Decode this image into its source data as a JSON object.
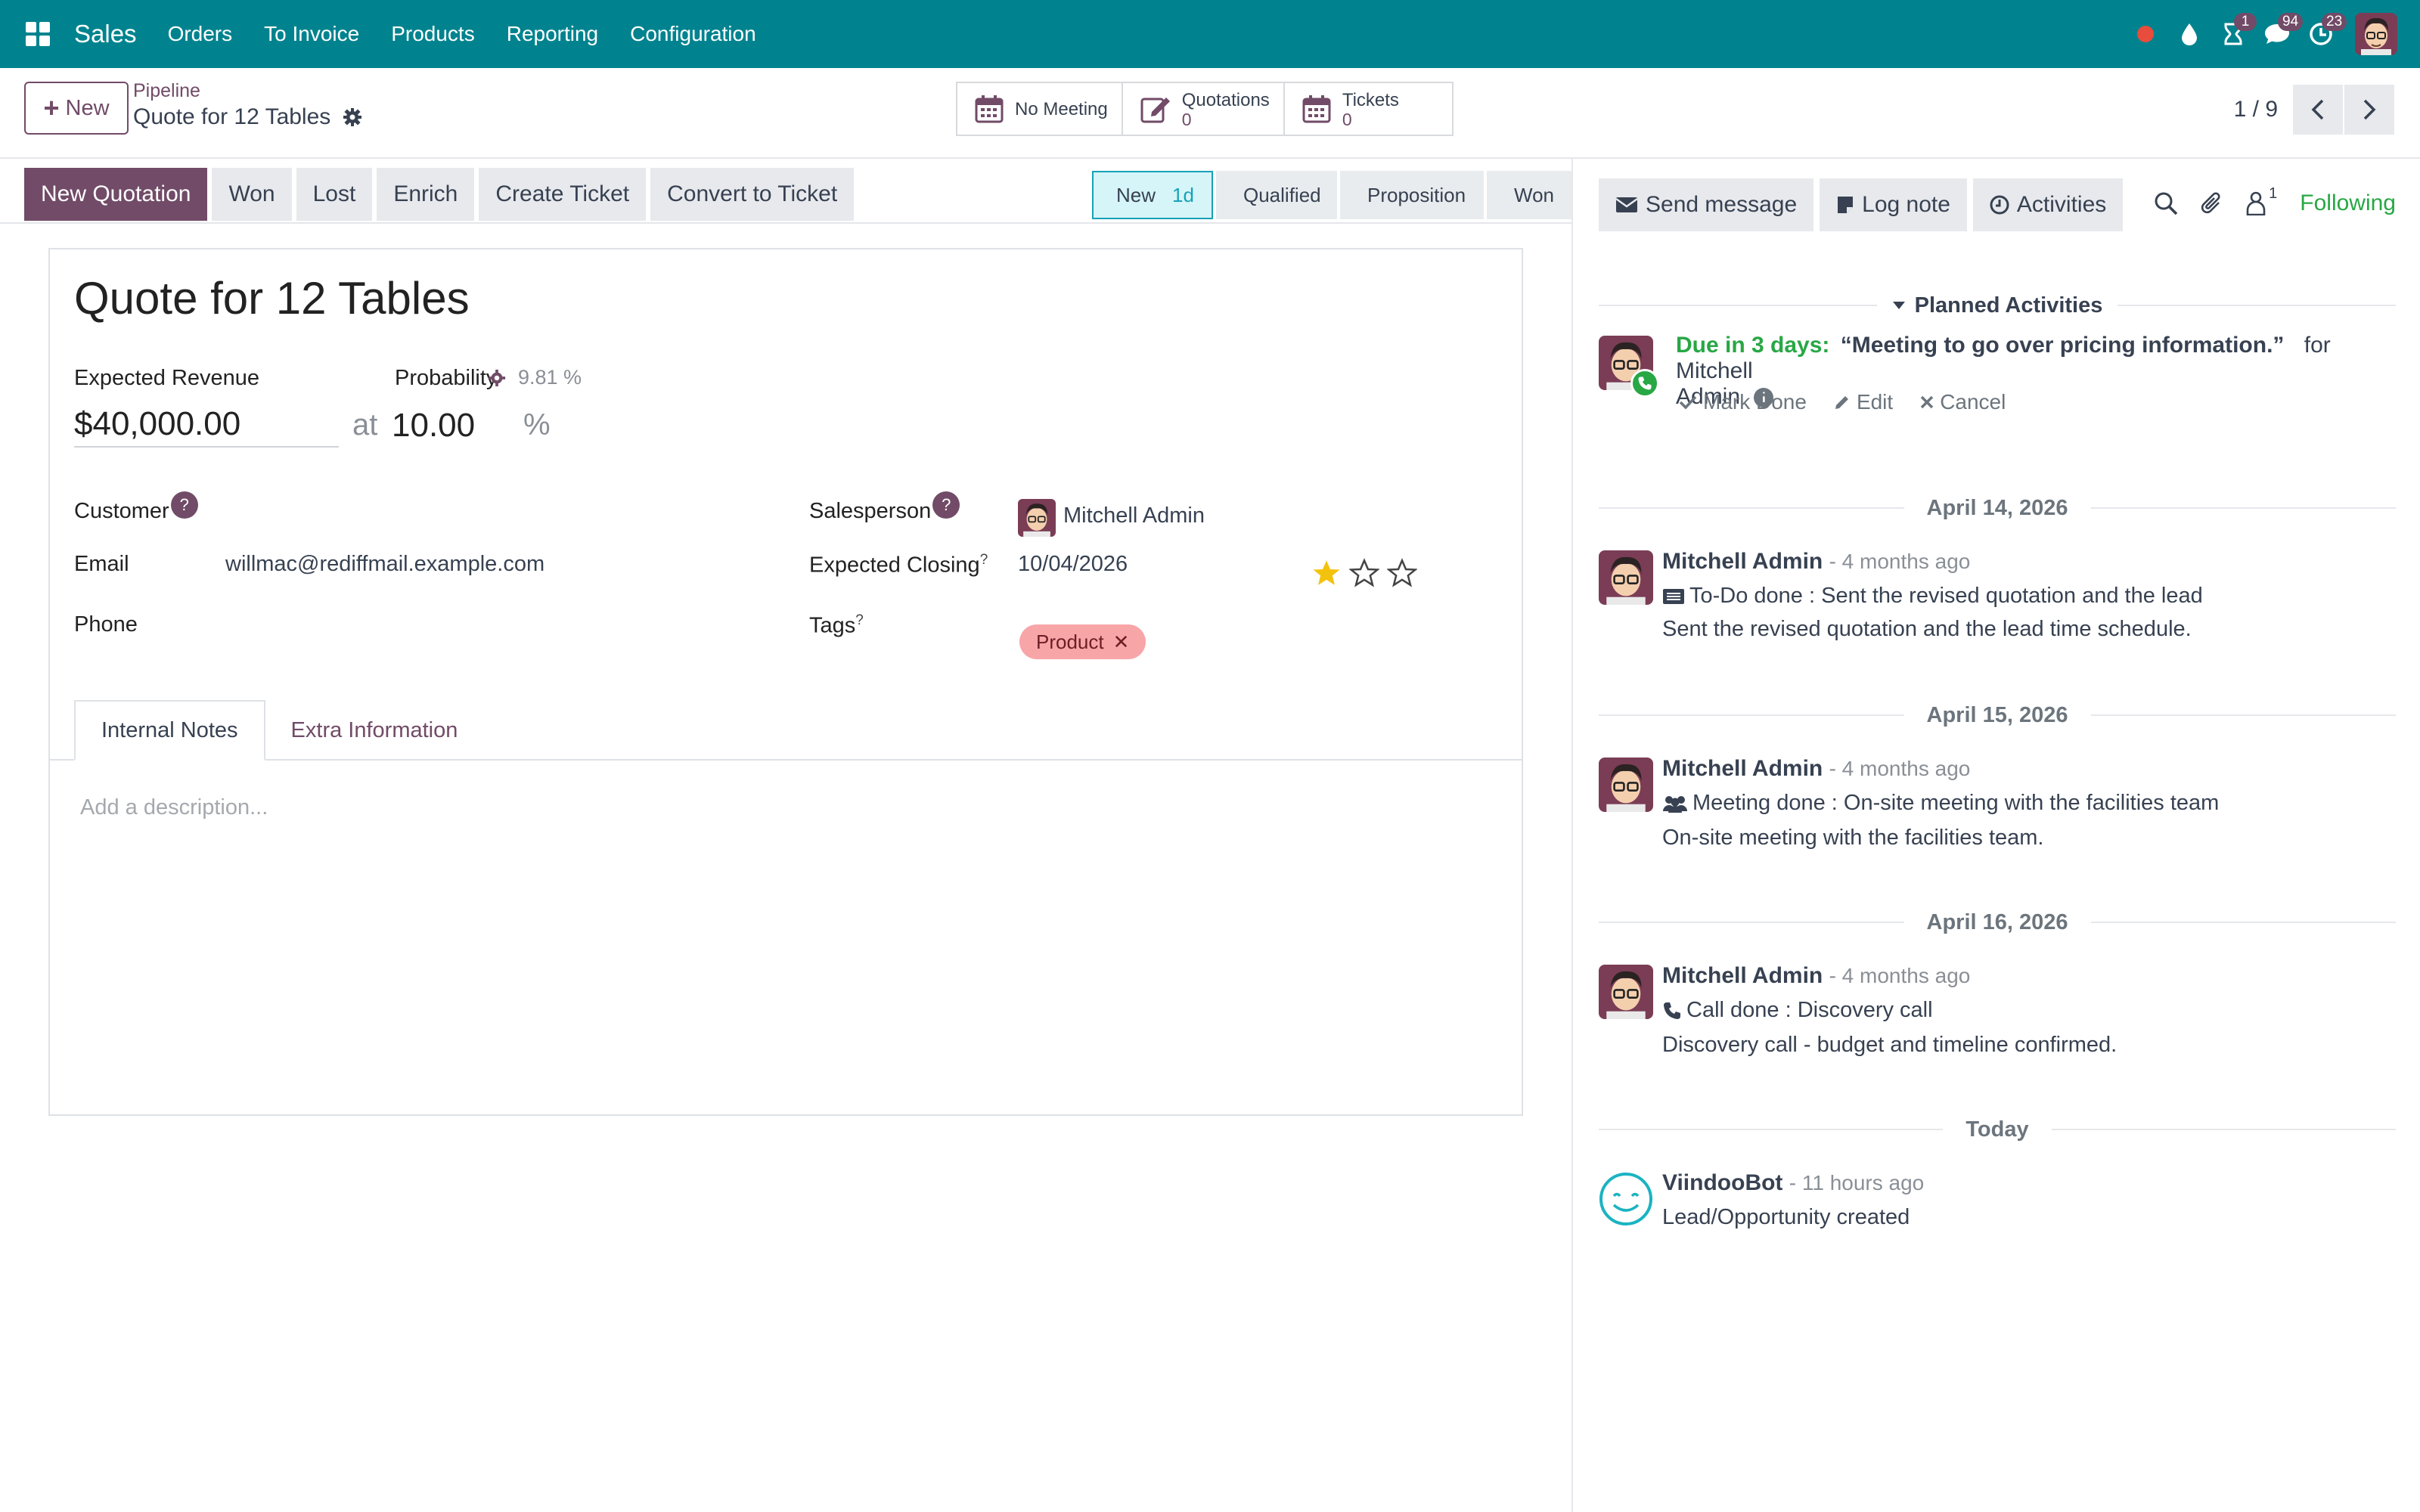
{
  "navbar": {
    "brand": "Sales",
    "menu": [
      "Orders",
      "To Invoice",
      "Products",
      "Reporting",
      "Configuration"
    ],
    "badges": {
      "activities": "1",
      "messages": "94",
      "clock": "23"
    },
    "icons": [
      "apps-icon",
      "record-dot-icon",
      "droplet-icon",
      "hourglass-icon",
      "chat-icon",
      "clock-icon",
      "user-avatar"
    ]
  },
  "control_panel": {
    "new_label": "New",
    "breadcrumb": "Pipeline",
    "record_title": "Quote for 12 Tables",
    "smart_buttons": [
      {
        "label": "No Meeting",
        "count": ""
      },
      {
        "label": "Quotations",
        "count": "0"
      },
      {
        "label": "Tickets",
        "count": "0"
      }
    ],
    "pager": "1 / 9"
  },
  "statusbar": {
    "actions": [
      "New Quotation",
      "Won",
      "Lost",
      "Enrich",
      "Create Ticket",
      "Convert to Ticket"
    ],
    "stages": [
      {
        "label": "New",
        "duration": "1d",
        "active": true
      },
      {
        "label": "Qualified"
      },
      {
        "label": "Proposition"
      },
      {
        "label": "Won"
      }
    ]
  },
  "form": {
    "name": "Quote for 12 Tables",
    "expected_revenue_label": "Expected Revenue",
    "probability_label": "Probability",
    "automated_probability": "9.81 %",
    "expected_revenue": "$40,000.00",
    "at": "at",
    "probability": "10.00",
    "percent": "%",
    "customer_label": "Customer",
    "email_label": "Email",
    "email": "willmac@rediffmail.example.com",
    "phone_label": "Phone",
    "salesperson_label": "Salesperson",
    "salesperson": "Mitchell Admin",
    "expected_closing_label": "Expected Closing",
    "expected_closing": "10/04/2026",
    "priority_stars": 1,
    "tags_label": "Tags",
    "tag": "Product",
    "tabs": [
      "Internal Notes",
      "Extra Information"
    ],
    "description_placeholder": "Add a description..."
  },
  "chatter": {
    "buttons": [
      "Send message",
      "Log note",
      "Activities"
    ],
    "follower_count": "1",
    "following": "Following",
    "planned_title": "Planned Activities",
    "activity": {
      "due": "Due in 3 days:",
      "summary": "“Meeting to go over pricing information.”",
      "for": "for Mitchell",
      "for2": "Admin",
      "actions": [
        "Mark Done",
        "Edit",
        "Cancel"
      ]
    },
    "messages": [
      {
        "date": "April 14, 2026",
        "author": "Mitchell Admin",
        "time": "- 4 months ago",
        "line1": "To-Do done : Sent the revised quotation and the lead",
        "line2": "Sent the revised quotation and the lead time schedule."
      },
      {
        "date": "April 15, 2026",
        "author": "Mitchell Admin",
        "time": "- 4 months ago",
        "line1": "Meeting done : On-site meeting with the facilities team",
        "line2": "On-site meeting with the facilities team."
      },
      {
        "date": "April 16, 2026",
        "author": "Mitchell Admin",
        "time": "- 4 months ago",
        "line1": "Call done : Discovery call",
        "line2": "Discovery call - budget and timeline confirmed."
      },
      {
        "date": "Today",
        "author": "ViindooBot",
        "time": "- 11 hours ago",
        "line1": "Lead/Opportunity created",
        "line2": ""
      }
    ]
  }
}
